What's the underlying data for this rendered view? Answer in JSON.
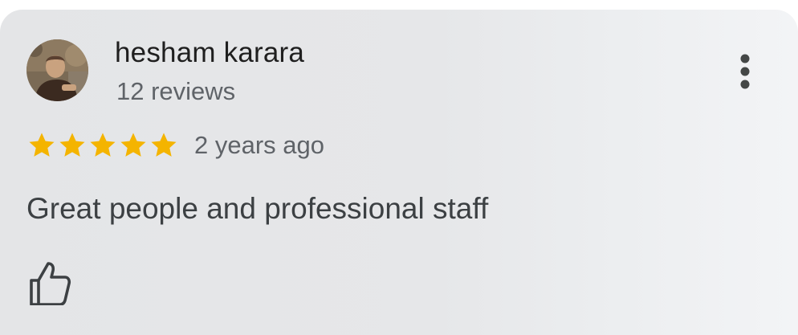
{
  "review": {
    "author_name": "hesham karara",
    "review_count": "12 reviews",
    "rating": 5,
    "rating_max": 5,
    "time_ago": "2 years ago",
    "text": "Great people and professional staff"
  },
  "icons": {
    "star": "star-icon",
    "more": "more-vert-icon",
    "like": "thumb-up-icon"
  },
  "colors": {
    "star": "#f4b400",
    "name": "#1f1f1f",
    "secondary": "#5f6368",
    "body": "#3c4043"
  }
}
